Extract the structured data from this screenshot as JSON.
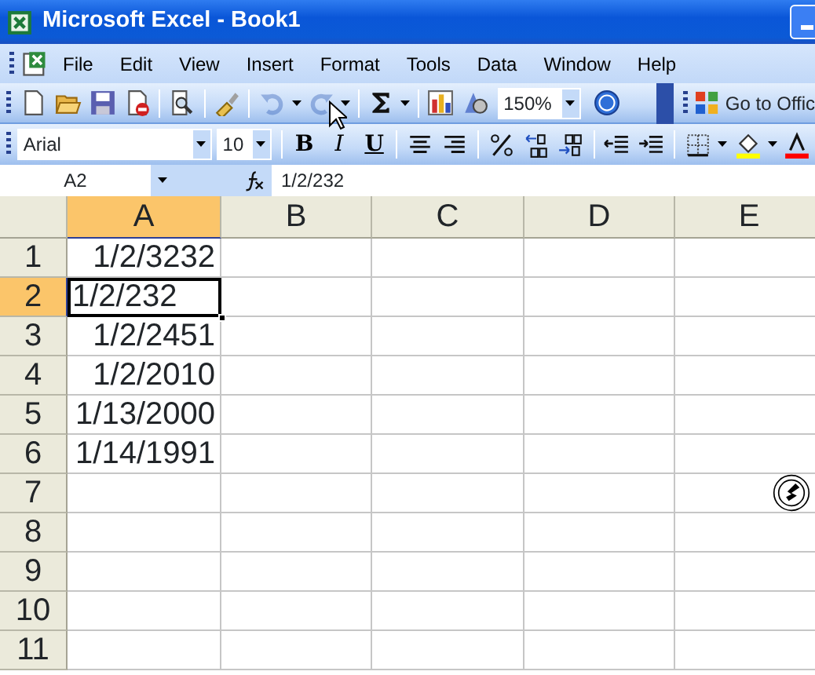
{
  "window": {
    "title": "Microsoft Excel - Book1"
  },
  "menu": [
    {
      "label": "File"
    },
    {
      "label": "Edit"
    },
    {
      "label": "View"
    },
    {
      "label": "Insert"
    },
    {
      "label": "Format"
    },
    {
      "label": "Tools"
    },
    {
      "label": "Data"
    },
    {
      "label": "Window"
    },
    {
      "label": "Help"
    }
  ],
  "standard_toolbar": {
    "undo": {
      "disabled": true
    },
    "redo": {
      "disabled": true
    },
    "zoom": "150%",
    "go_to_office": "Go to Offic"
  },
  "formatting_toolbar": {
    "font": "Arial",
    "size": "10",
    "bold": "B",
    "italic": "I",
    "underline": "U"
  },
  "formula_bar": {
    "name_box": "A2",
    "formula": "1/2/232"
  },
  "columns": [
    {
      "label": "A",
      "selected": true
    },
    {
      "label": "B",
      "selected": false
    },
    {
      "label": "C",
      "selected": false
    },
    {
      "label": "D",
      "selected": false
    },
    {
      "label": "E",
      "selected": false
    }
  ],
  "rows": [
    {
      "label": "1",
      "selected": false,
      "a": {
        "text": "1/2/3232",
        "kind": "number",
        "active": false
      }
    },
    {
      "label": "2",
      "selected": true,
      "a": {
        "text": "1/2/232",
        "kind": "text",
        "active": true
      }
    },
    {
      "label": "3",
      "selected": false,
      "a": {
        "text": "1/2/2451",
        "kind": "number",
        "active": false
      }
    },
    {
      "label": "4",
      "selected": false,
      "a": {
        "text": "1/2/2010",
        "kind": "number",
        "active": false
      }
    },
    {
      "label": "5",
      "selected": false,
      "a": {
        "text": "1/13/2000",
        "kind": "number",
        "active": false
      }
    },
    {
      "label": "6",
      "selected": false,
      "a": {
        "text": "1/14/1991",
        "kind": "number",
        "active": false
      }
    },
    {
      "label": "7",
      "selected": false
    },
    {
      "label": "8",
      "selected": false
    },
    {
      "label": "9",
      "selected": false
    },
    {
      "label": "10",
      "selected": false
    },
    {
      "label": "11",
      "selected": false
    }
  ]
}
